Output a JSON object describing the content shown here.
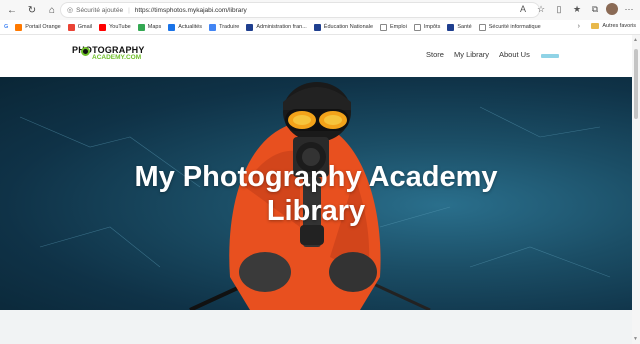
{
  "browser": {
    "security_label": "Sécurité ajoutée",
    "url": "https://timsphotos.mykajabi.com/library"
  },
  "bookmarks": [
    {
      "label": "Portail Orange",
      "color": "#ff7900"
    },
    {
      "label": "Gmail",
      "color": "#ea4335"
    },
    {
      "label": "YouTube",
      "color": "#ff0000"
    },
    {
      "label": "Maps",
      "color": "#34a853"
    },
    {
      "label": "Actualités",
      "color": "#1a73e8"
    },
    {
      "label": "Traduire",
      "color": "#4285f4"
    },
    {
      "label": "Administration fran...",
      "color": "#1f3f8f"
    },
    {
      "label": "Éducation Nationale",
      "color": "#1f3f8f"
    },
    {
      "label": "Emploi",
      "color": "#888888"
    },
    {
      "label": "Impôts",
      "color": "#888888"
    },
    {
      "label": "Santé",
      "color": "#1f3f8f"
    },
    {
      "label": "Sécurité informatique",
      "color": "#888888"
    }
  ],
  "bookmarks_other": "Autres favoris",
  "site": {
    "logo_line1": "PHOTOGRAPHY",
    "logo_line2": "ACADEMY.COM",
    "nav": {
      "store": "Store",
      "library": "My Library",
      "about": "About Us"
    }
  },
  "hero": {
    "title_line1": "My Photography Academy",
    "title_line2": "Library"
  },
  "colors": {
    "accent_green": "#6fbf2a",
    "jacket_orange": "#e8501f"
  }
}
